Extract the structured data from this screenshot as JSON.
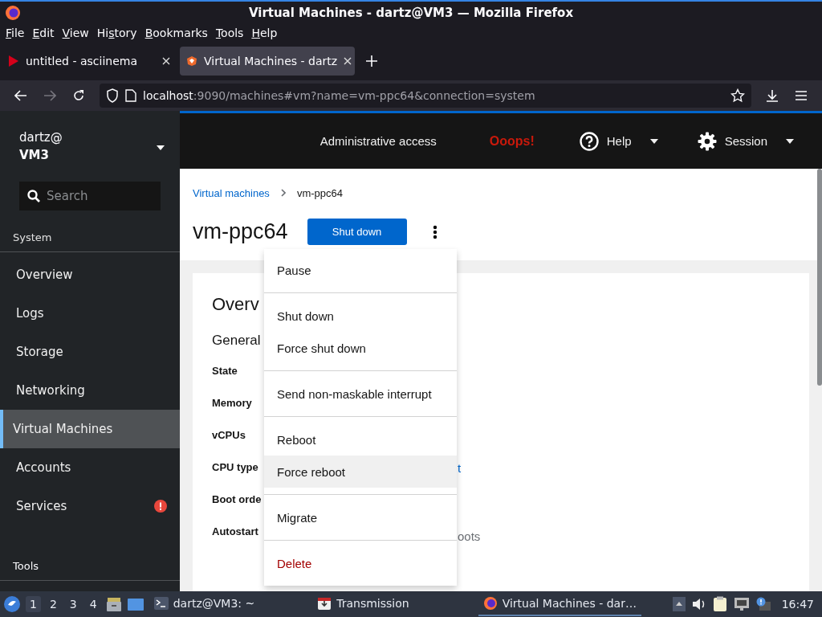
{
  "window": {
    "title": "Virtual Machines - dartz@VM3 — Mozilla Firefox"
  },
  "menu_bar": [
    {
      "key": "F",
      "after": "ile"
    },
    {
      "key": "E",
      "after": "dit"
    },
    {
      "key": "V",
      "after": "iew"
    },
    {
      "before": "Hi",
      "key": "s",
      "after": "tory"
    },
    {
      "key": "B",
      "after": "ookmarks"
    },
    {
      "key": "T",
      "after": "ools"
    },
    {
      "key": "H",
      "after": "elp"
    }
  ],
  "tabs": [
    {
      "label": "untitled - asciinema",
      "selected": false,
      "kind": "play"
    },
    {
      "label": "Virtual Machines - dartz",
      "selected": true,
      "kind": "shield"
    }
  ],
  "url": {
    "host": "localhost",
    "rest": ":9090/machines#vm?name=vm-ppc64&connection=system"
  },
  "sidebar": {
    "user": "dartz@",
    "host": "VM3",
    "search": {
      "placeholder": "Search"
    },
    "section": "System",
    "items": [
      {
        "label": "Overview",
        "selected": false,
        "alert": false
      },
      {
        "label": "Logs",
        "selected": false,
        "alert": false
      },
      {
        "label": "Storage",
        "selected": false,
        "alert": false
      },
      {
        "label": "Networking",
        "selected": false,
        "alert": false
      },
      {
        "label": "Virtual Machines",
        "selected": true,
        "alert": false
      },
      {
        "label": "Accounts",
        "selected": false,
        "alert": false
      },
      {
        "label": "Services",
        "selected": false,
        "alert": true
      }
    ],
    "footer_section": "Tools"
  },
  "header": {
    "access": "Administrative access",
    "error": "Ooops!",
    "help": "Help",
    "session": "Session"
  },
  "breadcrumb": [
    {
      "label": "Virtual machines",
      "kind": "link"
    },
    {
      "label": "vm-ppc64",
      "kind": "current"
    }
  ],
  "page_title": "vm-ppc64",
  "primary_button": "Shut down",
  "card": {
    "title": "Overv",
    "section": "General",
    "rows": [
      {
        "label": "State"
      },
      {
        "label": "Memory"
      },
      {
        "label": "vCPUs"
      },
      {
        "label": "CPU type",
        "value": "t",
        "kind": "link"
      },
      {
        "label": "Boot orde"
      },
      {
        "label": "Autostart",
        "value": "oots",
        "kind": "muted"
      }
    ]
  },
  "actions_menu": [
    [
      {
        "label": "Pause",
        "highlighted": false,
        "kind": "normal"
      }
    ],
    [
      {
        "label": "Shut down",
        "highlighted": false,
        "kind": "normal"
      },
      {
        "label": "Force shut down",
        "highlighted": false,
        "kind": "normal"
      }
    ],
    [
      {
        "label": "Send non-maskable interrupt",
        "highlighted": false,
        "kind": "normal"
      }
    ],
    [
      {
        "label": "Reboot",
        "highlighted": false,
        "kind": "normal"
      },
      {
        "label": "Force reboot",
        "highlighted": true,
        "kind": "normal"
      }
    ],
    [
      {
        "label": "Migrate",
        "highlighted": false,
        "kind": "normal"
      }
    ],
    [
      {
        "label": "Delete",
        "highlighted": false,
        "kind": "danger"
      }
    ]
  ],
  "taskbar": {
    "workspaces": [
      {
        "label": "1",
        "selected": true
      },
      {
        "label": "2",
        "selected": false
      },
      {
        "label": "3",
        "selected": false
      },
      {
        "label": "4",
        "selected": false
      }
    ],
    "tasks": [
      {
        "label": "dartz@VM3: ~",
        "kind": "terminal",
        "selected": false
      },
      {
        "label": "Transmission",
        "kind": "transmission",
        "selected": false
      },
      {
        "label": "Virtual Machines - dar…",
        "kind": "browser",
        "selected": true
      }
    ],
    "clock": "16:47"
  }
}
